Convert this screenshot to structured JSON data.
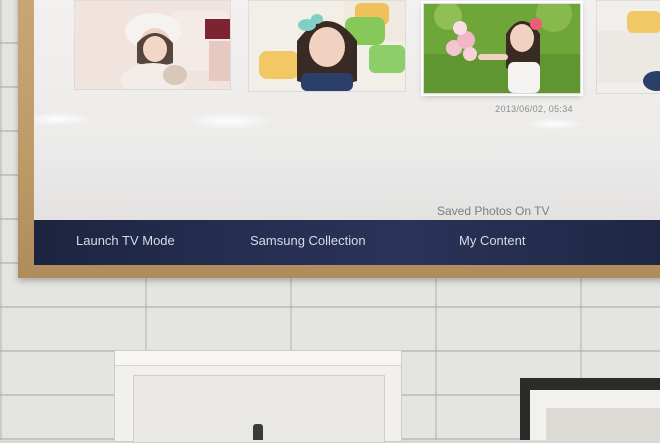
{
  "gallery": {
    "selected_timestamp": "2013/06/02, 05:34",
    "photos": [
      {
        "subject": "girl-in-white-hat"
      },
      {
        "subject": "girl-with-green-bow"
      },
      {
        "subject": "girl-with-flowers-on-grass"
      },
      {
        "subject": "partial-photo"
      }
    ]
  },
  "section_label": "Saved Photos On TV",
  "nav": {
    "items": [
      {
        "label": "Launch TV Mode"
      },
      {
        "label": "Samsung Collection"
      },
      {
        "label": "My Content"
      }
    ]
  },
  "colors": {
    "frame": "#c4a272",
    "nav_bar": "#262f52",
    "screen": "#eeedeb"
  }
}
